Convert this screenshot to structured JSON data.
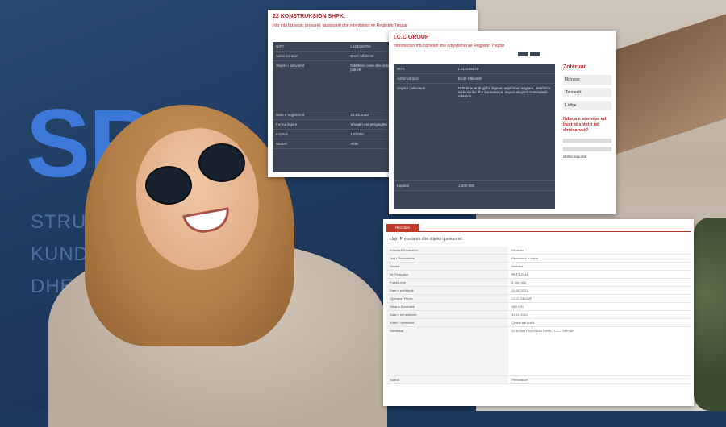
{
  "background": {
    "sign_letters": "SPA",
    "sign_lines": [
      "STRU",
      "KUNDE",
      "DHE K"
    ]
  },
  "panel1": {
    "title": "22 KONSTRUKSION SHPK.",
    "subtitle": "Info mbi biznesin, pronarët, aksionarët dhe ndryshimet në Regjistrin Tregtar",
    "rows": [
      {
        "k": "NIPT",
        "v": "L12345678A"
      },
      {
        "k": "Administratori",
        "v": "Emër Mbiemër"
      },
      {
        "k": "Objekti i aktivitetit",
        "v": "Ndërtime civile dhe industriale, punime ndërtimi, tregti me shumicë dhe pakicë"
      },
      {
        "k": "Data e regjistrimit",
        "v": "22.03.2019"
      },
      {
        "k": "Forma ligjore",
        "v": "Shoqëri me përgjegjësi të kufizuar"
      },
      {
        "k": "Kapitali",
        "v": "100 000"
      },
      {
        "k": "Statusi",
        "v": "Aktiv"
      }
    ]
  },
  "panel2": {
    "title": "I.C.C GROUP",
    "subtitle": "Informacion mbi biznesin dhe ndryshimet në Regjistrin Tregtar",
    "rows": [
      {
        "k": "NIPT",
        "v": "L21234567B"
      },
      {
        "k": "Administratori",
        "v": "Emër Mbiemër"
      },
      {
        "k": "Objekti i aktivitetit",
        "v": "Ndërtime të të gjitha llojeve, veprimtari tregtare, shërbime inxhinierike dhe konsulence, import eksport materialesh ndërtimi"
      },
      {
        "k": "Kapitali",
        "v": "1 000 000"
      }
    ],
    "sidebar_title": "Zotëruar",
    "sidebar_items": [
      "Biznese",
      "Tenderët",
      "Lidhje"
    ],
    "side_heading": "Ndarja e stemëve ed buxt të shtetit në shtënarvet?",
    "side_footer": "Shihni raportet"
  },
  "panel3": {
    "tab": "Rezultati",
    "heading": "Lloji i Procedurës dhe objekti i prokurimit",
    "rows": [
      {
        "k": "Autoriteti Kontraktor",
        "v": "Ministria"
      },
      {
        "k": "Lloji i Procedurës",
        "v": "Procedurë e hapur"
      },
      {
        "k": "Objekti",
        "v": "Ndërtim"
      },
      {
        "k": "Nr. Prokurimi",
        "v": "REF-12345"
      },
      {
        "k": "Fondi Limit",
        "v": "1 000 000"
      },
      {
        "k": "Data e publikimit",
        "v": "10.03.2021"
      },
      {
        "k": "Operatori Fitues",
        "v": "I.C.C GROUP"
      },
      {
        "k": "Vlera e Kontratës",
        "v": "980 000"
      },
      {
        "k": "Data e nënshkrimit",
        "v": "15.04.2021"
      },
      {
        "k": "Kriteri i vlerësimit",
        "v": "Çmimi më i ulët"
      },
      {
        "k": "Ofertuesit",
        "v": "22 KONSTRUKSION SHPK., I.C.C GROUP"
      },
      {
        "k": "Statusi",
        "v": "Përfunduar"
      }
    ]
  }
}
